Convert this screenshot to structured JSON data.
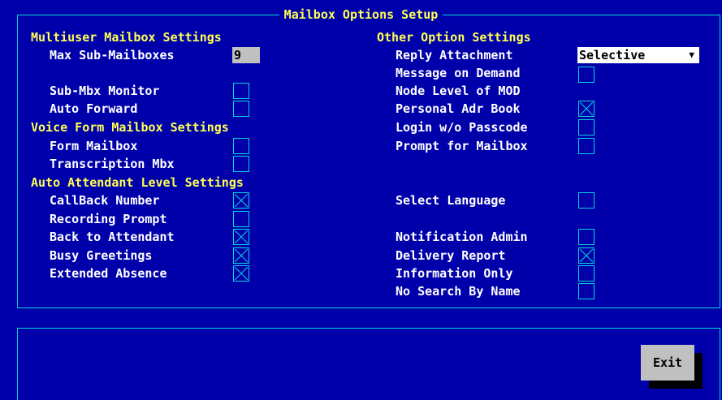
{
  "dialog": {
    "title": "Mailbox Options Setup"
  },
  "left": {
    "multiuser_header": "Multiuser Mailbox Settings",
    "max_sub_label": "Max Sub-Mailboxes",
    "max_sub_value": "9",
    "sub_mbx_monitor": {
      "label": "Sub-Mbx Monitor",
      "checked": false
    },
    "auto_forward": {
      "label": "Auto Forward",
      "checked": false
    },
    "voice_form_header": "Voice Form Mailbox Settings",
    "form_mailbox": {
      "label": "Form Mailbox",
      "checked": false
    },
    "transcription_mbx": {
      "label": "Transcription Mbx",
      "checked": false
    },
    "auto_attendant_header": "Auto Attendant Level Settings",
    "callback_number": {
      "label": "CallBack Number",
      "checked": true
    },
    "recording_prompt": {
      "label": "Recording Prompt",
      "checked": false
    },
    "back_to_attendant": {
      "label": "Back to Attendant",
      "checked": true
    },
    "busy_greetings": {
      "label": "Busy Greetings",
      "checked": true
    },
    "extended_absence": {
      "label": "Extended Absence",
      "checked": true
    }
  },
  "right": {
    "other_header": "Other Option Settings",
    "reply_attachment": {
      "label": "Reply Attachment",
      "value": "Selective",
      "arrow": "▼"
    },
    "message_on_demand": {
      "label": "Message on Demand",
      "checked": false
    },
    "node_level_mod": {
      "label": "Node Level of MOD"
    },
    "personal_adr_book": {
      "label": "Personal Adr Book",
      "checked": true
    },
    "login_wo_passcode": {
      "label": "Login w/o Passcode",
      "checked": false
    },
    "prompt_for_mailbox": {
      "label": "Prompt for Mailbox",
      "checked": false
    },
    "select_language": {
      "label": "Select Language",
      "checked": false
    },
    "notification_admin": {
      "label": "Notification Admin",
      "checked": false
    },
    "delivery_report": {
      "label": "Delivery Report",
      "checked": true
    },
    "information_only": {
      "label": "Information Only",
      "checked": false
    },
    "no_search_by_name": {
      "label": "No Search By Name",
      "checked": false
    }
  },
  "exit_label": "Exit",
  "colors": {
    "background": "#0000aa",
    "header_text": "#ffff55",
    "label_text": "#ffffff",
    "frame": "#00d8d8",
    "field_bg": "#c0c0c0"
  }
}
